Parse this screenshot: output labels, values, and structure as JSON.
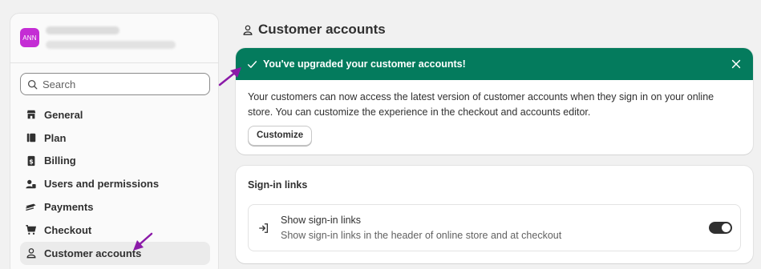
{
  "sidebar": {
    "avatar_initials": "ANN",
    "search": {
      "placeholder": "Search"
    },
    "items": [
      {
        "label": "General",
        "icon": "store-icon"
      },
      {
        "label": "Plan",
        "icon": "plan-icon"
      },
      {
        "label": "Billing",
        "icon": "billing-icon"
      },
      {
        "label": "Users and permissions",
        "icon": "users-icon"
      },
      {
        "label": "Payments",
        "icon": "payments-icon"
      },
      {
        "label": "Checkout",
        "icon": "cart-icon"
      },
      {
        "label": "Customer accounts",
        "icon": "person-icon",
        "active": true
      }
    ]
  },
  "main": {
    "title": "Customer accounts",
    "banner": {
      "title": "You've upgraded your customer accounts!",
      "body": "Your customers can now access the latest version of customer accounts when they sign in on your online store. You can customize the experience in the checkout and accounts editor.",
      "button_label": "Customize",
      "color": "#047b5d"
    },
    "signin_card": {
      "title": "Sign-in links",
      "setting_title": "Show sign-in links",
      "setting_desc": "Show sign-in links in the header of online store and at checkout",
      "toggle_on": true
    }
  },
  "annotations": {
    "arrow_color": "#8b1aa8"
  }
}
